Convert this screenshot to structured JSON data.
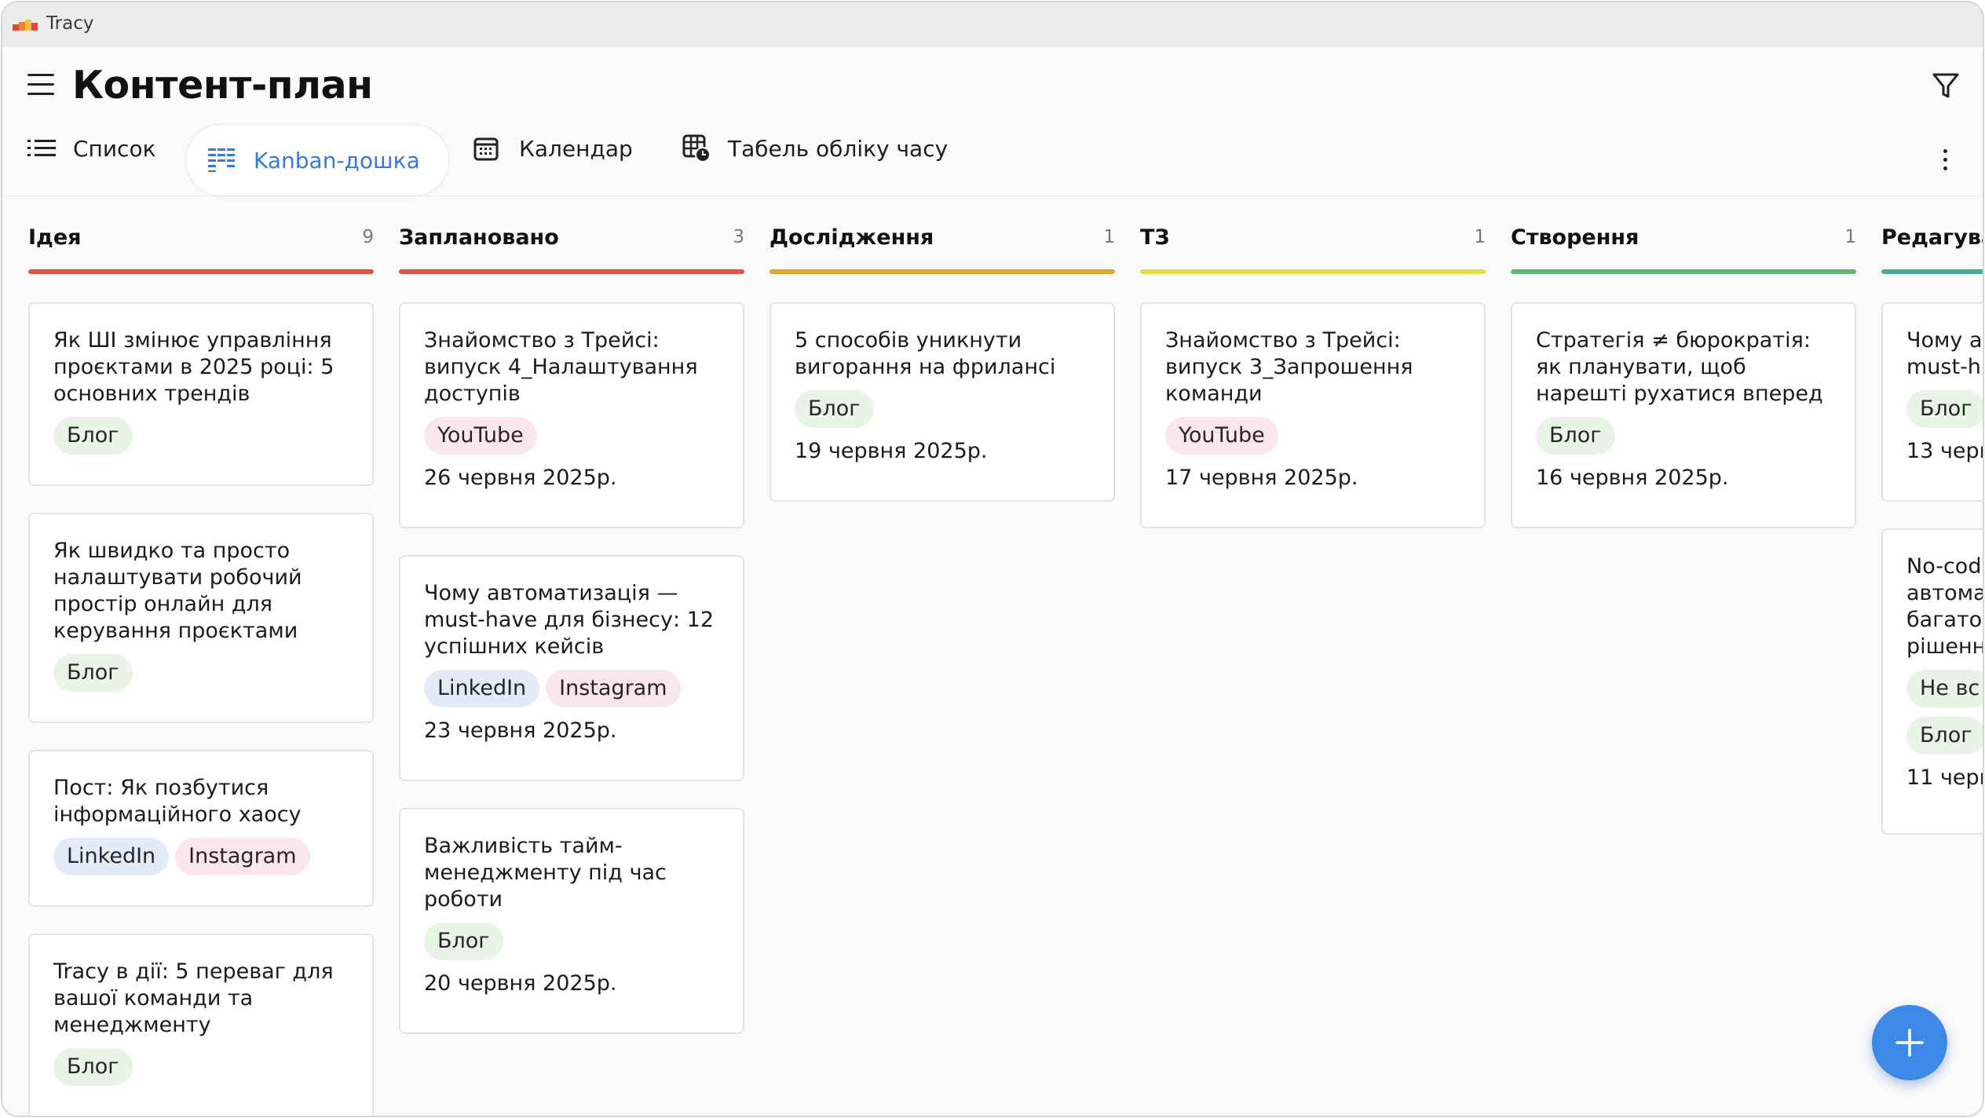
{
  "app": {
    "name": "Tracy"
  },
  "header": {
    "title": "Контент-план"
  },
  "tabs": [
    {
      "label": "Список",
      "active": false,
      "icon": "list-icon"
    },
    {
      "label": "Kanban-дошка",
      "active": true,
      "icon": "kanban-icon"
    },
    {
      "label": "Календар",
      "active": false,
      "icon": "calendar-icon"
    },
    {
      "label": "Табель обліку часу",
      "active": false,
      "icon": "timesheet-icon"
    }
  ],
  "colors": {
    "accent": "#3478e0",
    "idea": "#d9583d",
    "planned": "#d9583d",
    "research": "#e0a530",
    "spec": "#e6dd4d",
    "creation": "#5cb876",
    "editing": "#4aab9c"
  },
  "columns": [
    {
      "title": "Ідея",
      "count": "9",
      "cards": [
        {
          "title": "Як ШІ змінює управління проєктами в 2025 році: 5 основних трендів",
          "tags": [
            "Блог"
          ],
          "date": ""
        },
        {
          "title": "Як швидко та просто налаштувати робочий простір онлайн для керування проєктами",
          "tags": [
            "Блог"
          ],
          "date": ""
        },
        {
          "title": "Пост: Як позбутися інформаційного хаосу",
          "tags": [
            "LinkedIn",
            "Instagram"
          ],
          "date": ""
        },
        {
          "title": "Tracy в дії: 5 переваг для вашої команди та менеджменту",
          "tags": [
            "Блог"
          ],
          "date": ""
        }
      ]
    },
    {
      "title": "Заплановано",
      "count": "3",
      "cards": [
        {
          "title": "Знайомство з Трейсі: випуск 4_Налаштування доступів",
          "tags": [
            "YouTube"
          ],
          "date": "26 червня 2025р."
        },
        {
          "title": "Чому автоматизація — must-have для бізнесу: 12 успішних кейсів",
          "tags": [
            "LinkedIn",
            "Instagram"
          ],
          "date": "23 червня 2025р."
        },
        {
          "title": "Важливість тайм-менеджменту під час роботи",
          "tags": [
            "Блог"
          ],
          "date": "20 червня 2025р."
        }
      ]
    },
    {
      "title": "Дослідження",
      "count": "1",
      "cards": [
        {
          "title": "5 способів уникнути вигорання на фрилансі",
          "tags": [
            "Блог"
          ],
          "date": "19 червня 2025р."
        }
      ]
    },
    {
      "title": "ТЗ",
      "count": "1",
      "cards": [
        {
          "title": "Знайомство з Трейсі: випуск 3_Запрошення команди",
          "tags": [
            "YouTube"
          ],
          "date": "17 червня 2025р."
        }
      ]
    },
    {
      "title": "Створення",
      "count": "1",
      "cards": [
        {
          "title": "Стратегія ≠ бюрократія: як планувати, щоб нарешті рухатися вперед",
          "tags": [
            "Блог"
          ],
          "date": "16 червня 2025р."
        }
      ]
    },
    {
      "title": "Редагува",
      "cards": [
        {
          "title_lines": [
            "Чому а",
            "must-h"
          ],
          "tags": [
            "Блог"
          ],
          "date": "13 черв"
        },
        {
          "title_lines": [
            "No-cod",
            "автома",
            "багато",
            "рішенн"
          ],
          "tags": [
            "Не вс",
            "Блог"
          ],
          "date": "11 черв"
        }
      ]
    }
  ]
}
